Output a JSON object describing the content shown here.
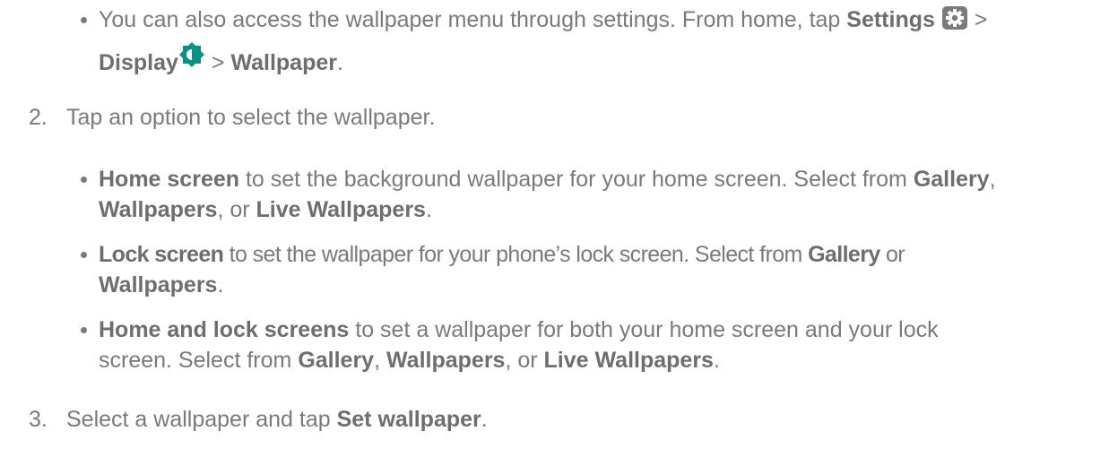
{
  "intro_bullet": {
    "line1_text": "You can also access the wallpaper menu through settings. From home, tap ",
    "settings": "Settings",
    "sep1": " >",
    "display": "Display",
    "sep2": " > ",
    "wallpaper": "Wallpaper",
    "end": "."
  },
  "step2": {
    "number": "2.",
    "text": "Tap an option to select the wallpaper."
  },
  "options": [
    {
      "label": "Home screen",
      "text1": " to set the background wallpaper for your home screen. Select from ",
      "gallery": "Gallery",
      "comma": ",",
      "wallpapers": "Wallpapers",
      "or": ", or ",
      "live": "Live Wallpapers",
      "end": "."
    },
    {
      "label": "Lock screen",
      "text1": " to set the wallpaper for your phone’s lock screen. Select from ",
      "gallery": "Gallery",
      "or": " or",
      "wallpapers": "Wallpapers",
      "end": "."
    },
    {
      "label": "Home and lock screens",
      "text1": " to set a wallpaper for both your home screen and your lock",
      "text2": "screen. Select from ",
      "gallery": "Gallery",
      "comma": ", ",
      "wallpapers": "Wallpapers",
      "or": ", or ",
      "live": "Live Wallpapers",
      "end": "."
    }
  ],
  "step3": {
    "number": "3.",
    "text": "Select a wallpaper and tap ",
    "bold": "Set wallpaper",
    "end": "."
  },
  "icons": {
    "settings_color": "#7a7a7a",
    "display_color": "#0a8f86"
  }
}
